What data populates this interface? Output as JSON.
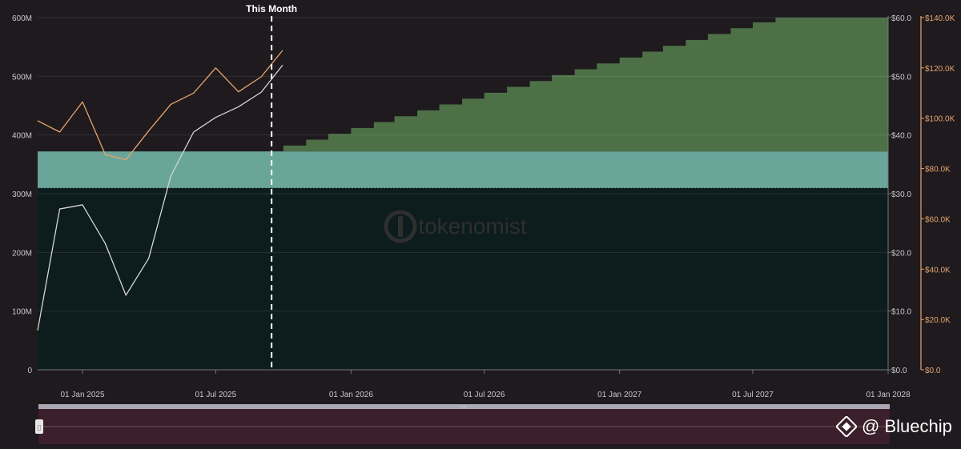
{
  "chart_data": {
    "type": "area",
    "annotation": "This Month",
    "annotation_date": "2025-09-15",
    "x_range": [
      "2024-11-01",
      "2028-01-01"
    ],
    "x_ticks": [
      {
        "date": "2025-01-01",
        "label": "01 Jan 2025"
      },
      {
        "date": "2025-07-01",
        "label": "01 Jul 2025"
      },
      {
        "date": "2026-01-01",
        "label": "01 Jan 2026"
      },
      {
        "date": "2026-07-01",
        "label": "01 Jul 2026"
      },
      {
        "date": "2027-01-01",
        "label": "01 Jan 2027"
      },
      {
        "date": "2027-07-01",
        "label": "01 Jul 2027"
      },
      {
        "date": "2028-01-01",
        "label": "01 Jan 2028"
      }
    ],
    "y_left": {
      "ylim": [
        0,
        600000000
      ],
      "ticks": [
        {
          "value": 0,
          "label": "0"
        },
        {
          "value": 100000000,
          "label": "100M"
        },
        {
          "value": 200000000,
          "label": "200M"
        },
        {
          "value": 300000000,
          "label": "300M"
        },
        {
          "value": 400000000,
          "label": "400M"
        },
        {
          "value": 500000000,
          "label": "500M"
        },
        {
          "value": 600000000,
          "label": "600M"
        }
      ]
    },
    "y_mid": {
      "ylim": [
        0,
        60
      ],
      "ticks": [
        {
          "value": 0,
          "label": "$0.0"
        },
        {
          "value": 10,
          "label": "$10.0"
        },
        {
          "value": 20,
          "label": "$20.0"
        },
        {
          "value": 30,
          "label": "$30.0"
        },
        {
          "value": 40,
          "label": "$40.0"
        },
        {
          "value": 50,
          "label": "$50.0"
        },
        {
          "value": 60,
          "label": "$60.0"
        }
      ]
    },
    "y_right": {
      "ylim": [
        0,
        140000
      ],
      "ticks": [
        {
          "value": 0,
          "label": "$0.0"
        },
        {
          "value": 20000,
          "label": "$20.0K"
        },
        {
          "value": 40000,
          "label": "$40.0K"
        },
        {
          "value": 60000,
          "label": "$60.0K"
        },
        {
          "value": 80000,
          "label": "$80.0K"
        },
        {
          "value": 100000,
          "label": "$100.0K"
        },
        {
          "value": 120000,
          "label": "$120.0K"
        },
        {
          "value": 140000,
          "label": "$140.0K"
        }
      ]
    },
    "colors": {
      "base_area": "#0d1c1c",
      "band_area": "#6aa59a",
      "unlock_area": "#4d7047",
      "white_line": "#d6d6d6",
      "orange_line": "#e8a56e",
      "annotation_line": "#ffffff",
      "right_axis": "#e8a56e"
    },
    "series": [
      {
        "axis": "left",
        "kind": "area",
        "values": [
          {
            "x": "2024-11-01",
            "y": 310000000
          },
          {
            "x": "2028-01-01",
            "y": 310000000
          }
        ]
      },
      {
        "axis": "left",
        "kind": "band",
        "values": [
          {
            "x": "2024-11-01",
            "y0": 310000000,
            "y1": 372000000
          },
          {
            "x": "2028-01-01",
            "y0": 310000000,
            "y1": 372000000
          }
        ]
      },
      {
        "axis": "left",
        "kind": "step",
        "values": [
          {
            "x": "2025-10-01",
            "y": 382000000
          },
          {
            "x": "2025-11-01",
            "y": 392000000
          },
          {
            "x": "2025-12-01",
            "y": 402000000
          },
          {
            "x": "2026-01-01",
            "y": 412000000
          },
          {
            "x": "2026-02-01",
            "y": 422000000
          },
          {
            "x": "2026-03-01",
            "y": 432000000
          },
          {
            "x": "2026-04-01",
            "y": 442000000
          },
          {
            "x": "2026-05-01",
            "y": 452000000
          },
          {
            "x": "2026-06-01",
            "y": 462000000
          },
          {
            "x": "2026-07-01",
            "y": 472000000
          },
          {
            "x": "2026-08-01",
            "y": 482000000
          },
          {
            "x": "2026-09-01",
            "y": 492000000
          },
          {
            "x": "2026-10-01",
            "y": 502000000
          },
          {
            "x": "2026-11-01",
            "y": 512000000
          },
          {
            "x": "2026-12-01",
            "y": 522000000
          },
          {
            "x": "2027-01-01",
            "y": 532000000
          },
          {
            "x": "2027-02-01",
            "y": 542000000
          },
          {
            "x": "2027-03-01",
            "y": 552000000
          },
          {
            "x": "2027-04-01",
            "y": 562000000
          },
          {
            "x": "2027-05-01",
            "y": 572000000
          },
          {
            "x": "2027-06-01",
            "y": 582000000
          },
          {
            "x": "2027-07-01",
            "y": 592000000
          },
          {
            "x": "2027-08-01",
            "y": 600000000
          },
          {
            "x": "2027-09-01",
            "y": 610000000
          },
          {
            "x": "2027-10-01",
            "y": 610000000
          },
          {
            "x": "2027-11-01",
            "y": 610000000
          },
          {
            "x": "2027-12-01",
            "y": 610000000
          },
          {
            "x": "2028-01-01",
            "y": 610000000
          }
        ]
      },
      {
        "axis": "mid",
        "kind": "line",
        "values": [
          {
            "x": "2024-11-01",
            "y": 6.7
          },
          {
            "x": "2024-12-01",
            "y": 27.4
          },
          {
            "x": "2025-01-01",
            "y": 28.1
          },
          {
            "x": "2025-02-01",
            "y": 21.5
          },
          {
            "x": "2025-03-01",
            "y": 12.7
          },
          {
            "x": "2025-04-01",
            "y": 19.0
          },
          {
            "x": "2025-05-01",
            "y": 33.0
          },
          {
            "x": "2025-06-01",
            "y": 40.5
          },
          {
            "x": "2025-07-01",
            "y": 43.0
          },
          {
            "x": "2025-08-01",
            "y": 44.8
          },
          {
            "x": "2025-09-01",
            "y": 47.3
          },
          {
            "x": "2025-09-30",
            "y": 51.9
          }
        ]
      },
      {
        "axis": "right",
        "kind": "line",
        "values": [
          {
            "x": "2024-11-01",
            "y": 99000
          },
          {
            "x": "2024-12-01",
            "y": 94500
          },
          {
            "x": "2025-01-01",
            "y": 106500
          },
          {
            "x": "2025-02-01",
            "y": 85500
          },
          {
            "x": "2025-03-01",
            "y": 83500
          },
          {
            "x": "2025-04-01",
            "y": 95000
          },
          {
            "x": "2025-05-01",
            "y": 105500
          },
          {
            "x": "2025-06-01",
            "y": 110000
          },
          {
            "x": "2025-07-01",
            "y": 120000
          },
          {
            "x": "2025-08-01",
            "y": 110500
          },
          {
            "x": "2025-09-01",
            "y": 116500
          },
          {
            "x": "2025-09-30",
            "y": 127000
          }
        ]
      }
    ]
  },
  "watermark": {
    "text": "tokenomist"
  },
  "navigator": {
    "handle_glyph": "▯",
    "grip_glyph": "···"
  },
  "brand": {
    "handle": "@ Bluechip"
  }
}
